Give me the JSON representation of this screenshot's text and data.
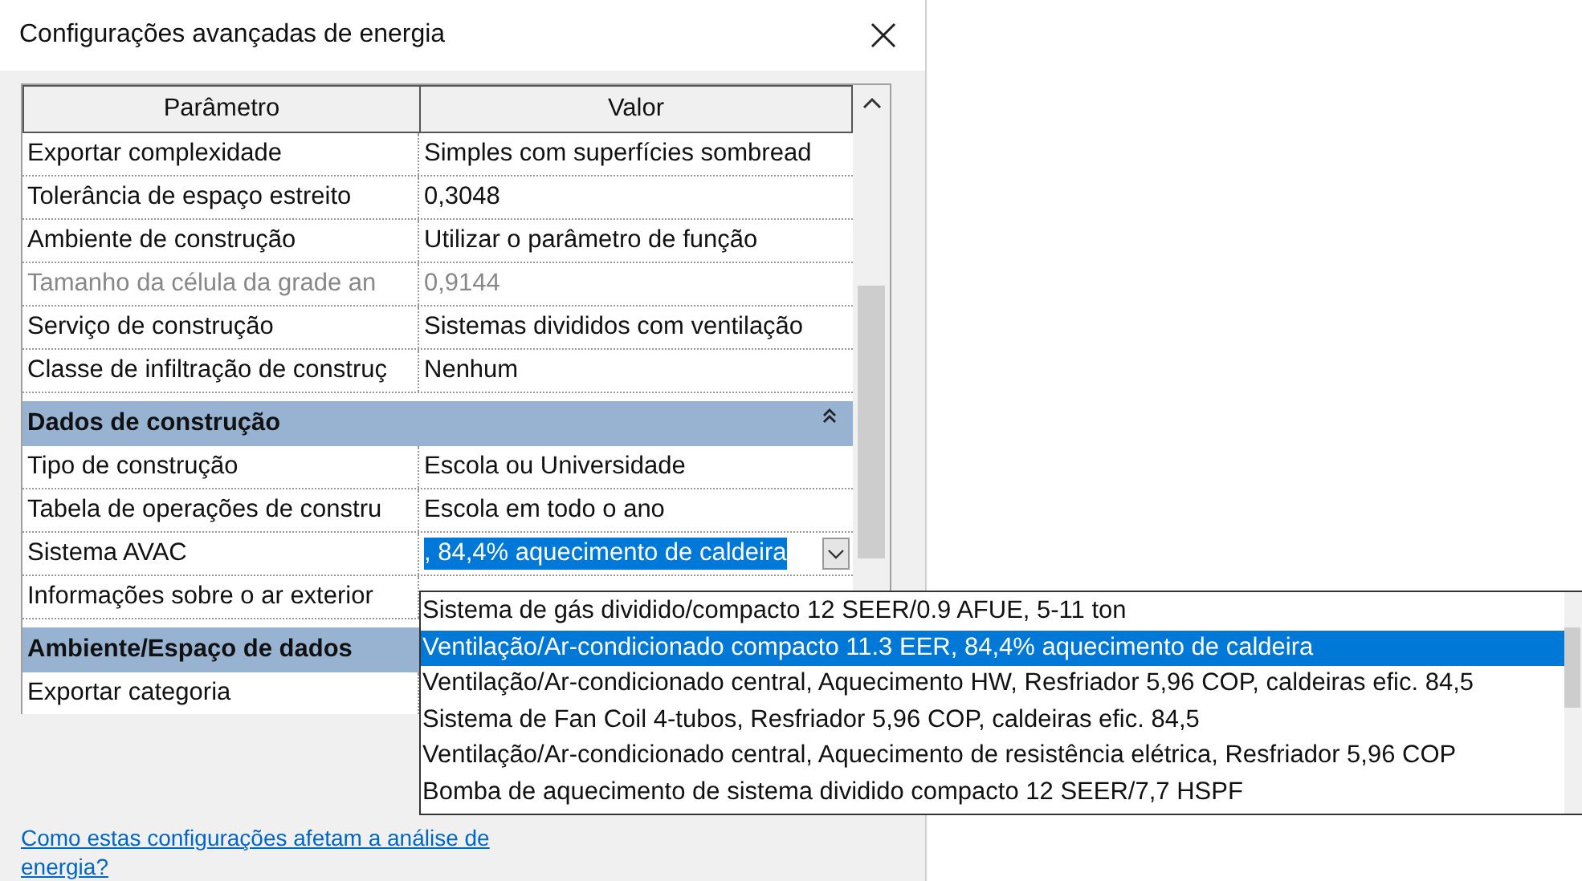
{
  "window": {
    "title": "Configurações avançadas de energia"
  },
  "table": {
    "columns": [
      "Parâmetro",
      "Valor"
    ],
    "rows": [
      {
        "kind": "param",
        "name": "Exportar complexidade",
        "value": "Simples com superfícies sombread",
        "disabled": false
      },
      {
        "kind": "param",
        "name": "Tolerância de espaço estreito",
        "value": "0,3048",
        "disabled": false
      },
      {
        "kind": "param",
        "name": "Ambiente de construção",
        "value": "Utilizar o parâmetro de função",
        "disabled": false
      },
      {
        "kind": "param",
        "name": "Tamanho da célula da grade an",
        "value": "0,9144",
        "disabled": true
      },
      {
        "kind": "param",
        "name": "Serviço de construção",
        "value": "Sistemas divididos com ventilação",
        "disabled": false
      },
      {
        "kind": "param",
        "name": "Classe de infiltração de construç",
        "value": "Nenhum",
        "disabled": false
      },
      {
        "kind": "group",
        "name": "Dados de construção",
        "expanded": true
      },
      {
        "kind": "param",
        "name": "Tipo de construção",
        "value": "Escola ou Universidade",
        "disabled": false
      },
      {
        "kind": "param",
        "name": "Tabela de operações de constru",
        "value": "Escola em todo o ano",
        "disabled": false
      },
      {
        "kind": "combo",
        "name": "Sistema AVAC",
        "value": ", 84,4% aquecimento de caldeira"
      },
      {
        "kind": "param",
        "name": "Informações sobre o ar exterior",
        "disabled": false
      },
      {
        "kind": "group",
        "name": "Ambiente/Espaço de dados"
      },
      {
        "kind": "param",
        "name": "Exportar categoria",
        "disabled": false
      }
    ]
  },
  "dropdown": {
    "options": [
      {
        "label": "Sistema de gás dividido/compacto 12 SEER/0.9 AFUE, 5-11 ton",
        "selected": false
      },
      {
        "label": "Ventilação/Ar-condicionado compacto 11.3 EER, 84,4% aquecimento de caldeira",
        "selected": true
      },
      {
        "label": "Ventilação/Ar-condicionado central, Aquecimento HW, Resfriador 5,96 COP, caldeiras efic. 84,5",
        "selected": false
      },
      {
        "label": "Sistema de Fan Coil 4-tubos, Resfriador 5,96 COP, caldeiras efic. 84,5",
        "selected": false
      },
      {
        "label": "Ventilação/Ar-condicionado central, Aquecimento de resistência elétrica, Resfriador 5,96 COP",
        "selected": false
      },
      {
        "label": "Bomba de aquecimento de sistema dividido compacto 12 SEER/7,7 HSPF",
        "selected": false
      }
    ]
  },
  "help_link": "Como estas configurações afetam a análise de energia?"
}
